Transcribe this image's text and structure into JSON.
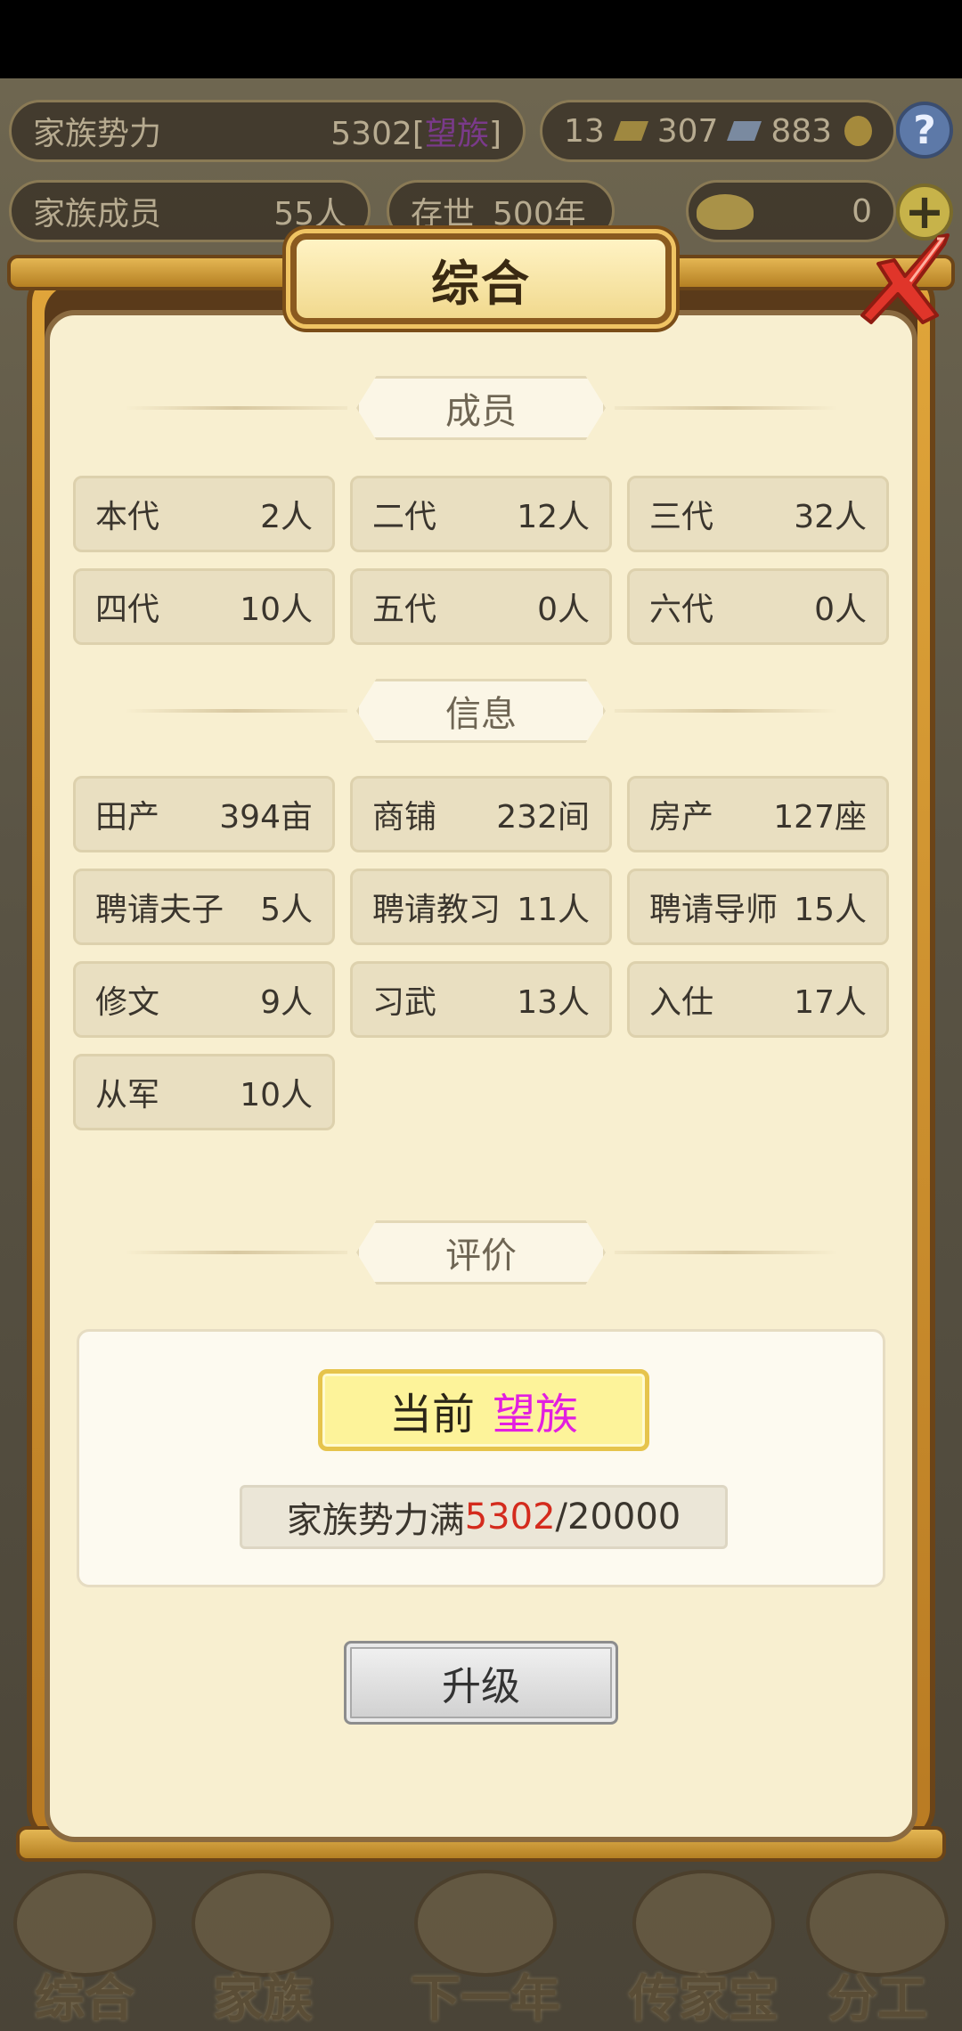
{
  "hud": {
    "clan_power_label": "家族势力",
    "clan_power_value": "5302",
    "clan_power_rank": "望族",
    "currency_1": "13",
    "currency_2": "307",
    "currency_3": "883",
    "members_label": "家族成员",
    "members_value": "55人",
    "existence_label": "存世",
    "existence_value": "500年",
    "ingot_value": "0",
    "help_icon": "?",
    "plus_icon": "+"
  },
  "modal": {
    "title": "综合",
    "members_section": {
      "title": "成员",
      "cells": [
        {
          "label": "本代",
          "value": "2人"
        },
        {
          "label": "二代",
          "value": "12人"
        },
        {
          "label": "三代",
          "value": "32人"
        },
        {
          "label": "四代",
          "value": "10人"
        },
        {
          "label": "五代",
          "value": "0人"
        },
        {
          "label": "六代",
          "value": "0人"
        }
      ]
    },
    "info_section": {
      "title": "信息",
      "cells": [
        {
          "label": "田产",
          "value": "394亩"
        },
        {
          "label": "商铺",
          "value": "232间"
        },
        {
          "label": "房产",
          "value": "127座"
        },
        {
          "label": "聘请夫子",
          "value": "5人"
        },
        {
          "label": "聘请教习",
          "value": "11人"
        },
        {
          "label": "聘请导师",
          "value": "15人"
        },
        {
          "label": "修文",
          "value": "9人"
        },
        {
          "label": "习武",
          "value": "13人"
        },
        {
          "label": "入仕",
          "value": "17人"
        },
        {
          "label": "从军",
          "value": "10人"
        }
      ]
    },
    "eval_section": {
      "title": "评价",
      "rank_prefix": "当前",
      "rank": "望族",
      "progress_label": "家族势力满",
      "progress_current": "5302",
      "progress_max": "/20000"
    },
    "upgrade_label": "升级"
  },
  "bottom_nav": [
    {
      "label": "综合"
    },
    {
      "label": "家族"
    },
    {
      "label": "下一年"
    },
    {
      "label": "传家宝"
    },
    {
      "label": "分工"
    }
  ],
  "colors": {
    "rank": "#e21fe0",
    "progress_current": "#d42b1d",
    "paper": "#f8efd0",
    "frame_gold": "#e0a53a"
  }
}
